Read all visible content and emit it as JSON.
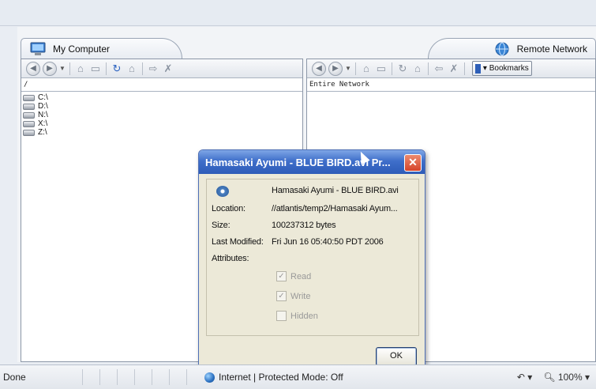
{
  "left_tab": {
    "label": "My Computer",
    "icon": "computer-icon"
  },
  "right_tab": {
    "label": "Remote Network",
    "icon": "network-globe-icon"
  },
  "left_pane": {
    "path": "/",
    "drives": [
      "C:\\",
      "D:\\",
      "N:\\",
      "X:\\",
      "Z:\\"
    ]
  },
  "right_pane": {
    "path": "Entire Network",
    "bookmarks_label": "▾ Bookmarks"
  },
  "dialog": {
    "title": "Hamasaki Ayumi - BLUE BIRD.avi Pr...",
    "filename": "Hamasaki Ayumi - BLUE BIRD.avi",
    "location_label": "Location:",
    "location_value": "//atlantis/temp2/Hamasaki Ayum...",
    "size_label": "Size:",
    "size_value": "100237312 bytes",
    "modified_label": "Last Modified:",
    "modified_value": "Fri Jun 16 05:40:50 PDT 2006",
    "attributes_label": "Attributes:",
    "attr_read": "Read",
    "attr_write": "Write",
    "attr_hidden": "Hidden",
    "ok_label": "OK",
    "close_glyph": "✕"
  },
  "statusbar": {
    "status": "Done",
    "zone": "Internet | Protected Mode: Off",
    "zoom": "100%"
  },
  "colors": {
    "title_bar": "#3f6fca",
    "close_button": "#d6442a",
    "dialog_face": "#ece9d8"
  }
}
